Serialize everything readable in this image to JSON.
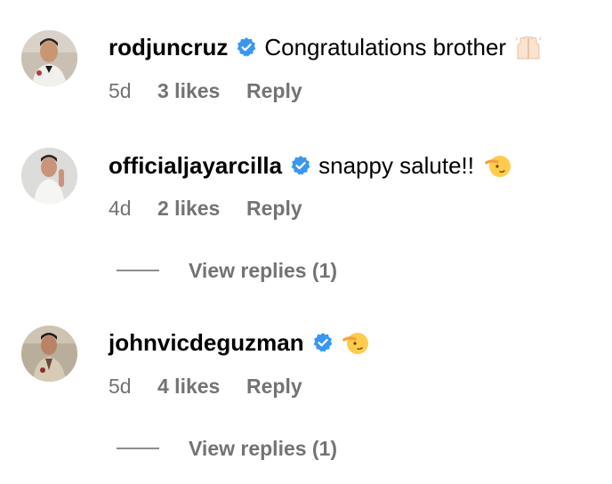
{
  "comments": [
    {
      "username": "rodjuncruz",
      "verified": true,
      "text": "Congratulations brother",
      "emoji": "raising-hands",
      "time": "5d",
      "likes": "3 likes",
      "reply": "Reply"
    },
    {
      "username": "officialjayarcilla",
      "verified": true,
      "text": "snappy salute!!",
      "emoji": "saluting-face",
      "time": "4d",
      "likes": "2 likes",
      "reply": "Reply",
      "view_replies": "View replies (1)"
    },
    {
      "username": "johnvicdeguzman",
      "verified": true,
      "text": "",
      "emoji": "saluting-face",
      "time": "5d",
      "likes": "4 likes",
      "reply": "Reply",
      "view_replies": "View replies (1)"
    }
  ],
  "colors": {
    "verified_badge": "#3897f0",
    "meta_text": "#737373",
    "divider": "#8e8e8e"
  }
}
